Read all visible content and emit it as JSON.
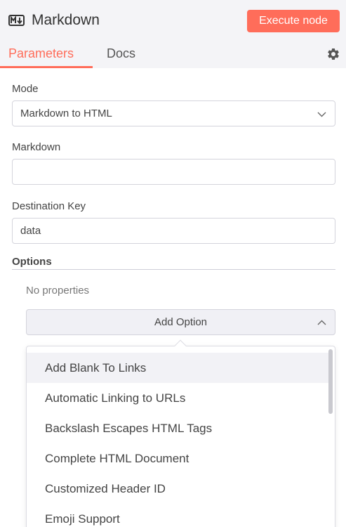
{
  "header": {
    "node_title": "Markdown",
    "node_icon": "markdown-icon",
    "execute_label": "Execute node",
    "accent_color": "#ff6d5a"
  },
  "tabs": [
    {
      "label": "Parameters",
      "active": true
    },
    {
      "label": "Docs",
      "active": false
    }
  ],
  "settings_icon": "gear-icon",
  "form": {
    "mode": {
      "label": "Mode",
      "value": "Markdown to HTML"
    },
    "markdown": {
      "label": "Markdown",
      "value": ""
    },
    "destination_key": {
      "label": "Destination Key",
      "value": "data"
    }
  },
  "options": {
    "label": "Options",
    "empty_text": "No properties",
    "add_option_label": "Add Option",
    "dropdown_items": [
      "Add Blank To Links",
      "Automatic Linking to URLs",
      "Backslash Escapes HTML Tags",
      "Complete HTML Document",
      "Customized Header ID",
      "Emoji Support"
    ]
  }
}
